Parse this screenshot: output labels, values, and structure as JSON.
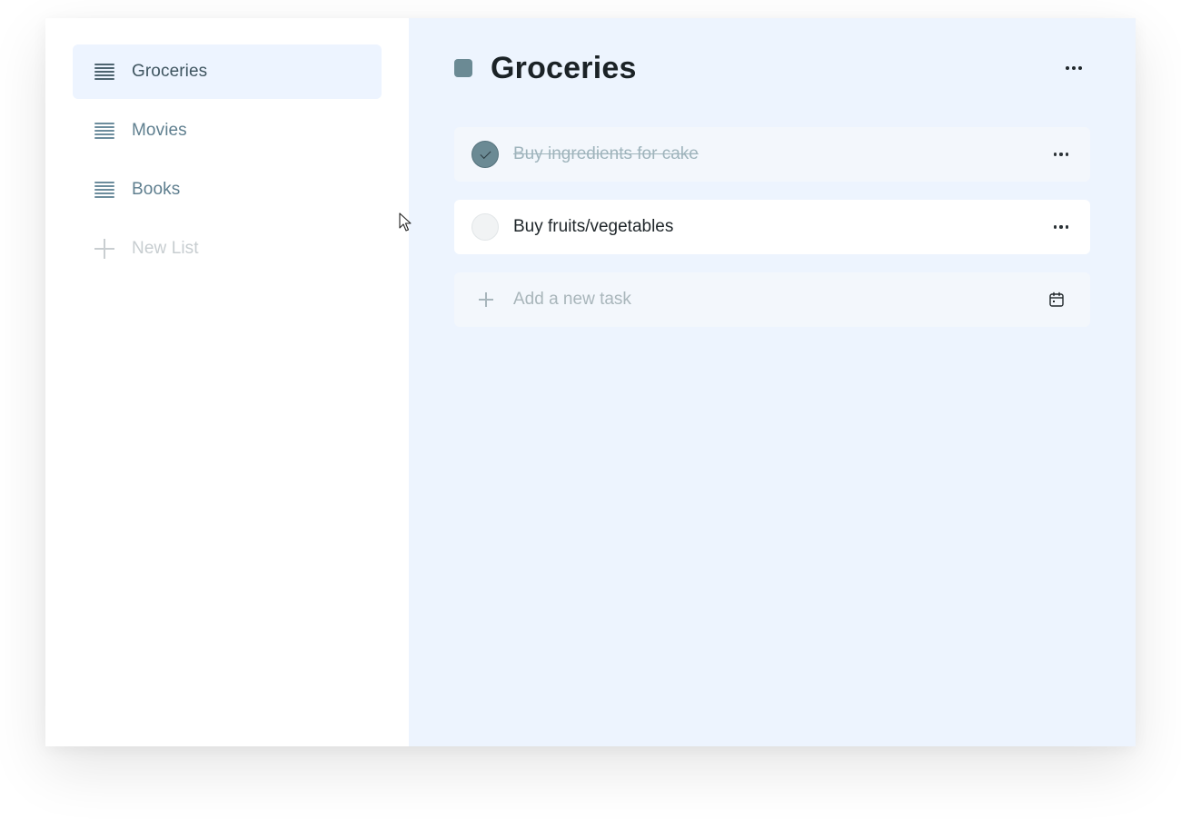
{
  "sidebar": {
    "items": [
      {
        "label": "Groceries",
        "icon": "list-icon",
        "active": true
      },
      {
        "label": "Movies",
        "icon": "list-icon",
        "active": false
      },
      {
        "label": "Books",
        "icon": "list-icon",
        "active": false
      }
    ],
    "new_list_label": "New List"
  },
  "main": {
    "title": "Groceries",
    "list_color": "#6b8a94",
    "background": "#edf4fe",
    "tasks": [
      {
        "text": "Buy ingredients for cake",
        "done": true
      },
      {
        "text": "Buy fruits/vegetables",
        "done": false
      }
    ],
    "add_task": {
      "placeholder": "Add a new task",
      "value": ""
    }
  },
  "icons": {
    "list": "list-icon",
    "add": "plus-icon",
    "more": "more-horizontal-icon",
    "calendar": "calendar-icon",
    "check": "checkmark-icon"
  }
}
